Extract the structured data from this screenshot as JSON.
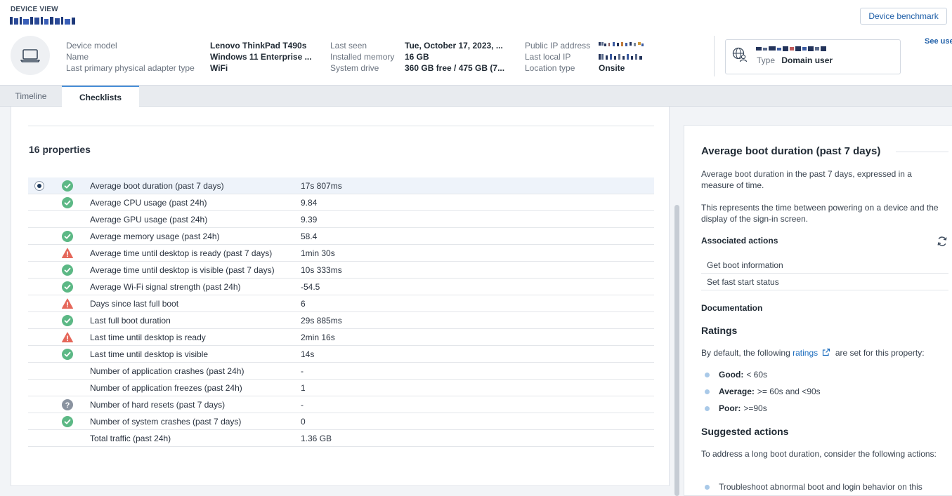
{
  "header": {
    "section_label": "DEVICE VIEW",
    "benchmark_button": "Device benchmark",
    "see_user_link": "See use",
    "properties": [
      {
        "label": "Device model",
        "value": "Lenovo ThinkPad T490s"
      },
      {
        "label": "Name",
        "value": "Windows 11 Enterprise ..."
      },
      {
        "label": "Last primary physical adapter type",
        "value": "WiFi"
      },
      {
        "label": "Last seen",
        "value": "Tue, October 17, 2023, ..."
      },
      {
        "label": "Installed memory",
        "value": "16 GB"
      },
      {
        "label": "System drive",
        "value": "360 GB free / 475 GB (7..."
      },
      {
        "label": "Public IP address",
        "value": ""
      },
      {
        "label": "Last local IP",
        "value": ""
      },
      {
        "label": "Location type",
        "value": "Onsite"
      }
    ],
    "user_card": {
      "type_label": "Type",
      "type_value": "Domain user"
    }
  },
  "tabs": [
    {
      "label": "Timeline",
      "active": false
    },
    {
      "label": "Checklists",
      "active": true
    }
  ],
  "main": {
    "properties_title": "16 properties",
    "rows": [
      {
        "name": "Average boot duration (past 7 days)",
        "value": "17s 807ms",
        "status": "good",
        "selected": true
      },
      {
        "name": "Average CPU usage (past 24h)",
        "value": "9.84",
        "status": "good"
      },
      {
        "name": "Average GPU usage (past 24h)",
        "value": "9.39",
        "status": "none"
      },
      {
        "name": "Average memory usage (past 24h)",
        "value": "58.4",
        "status": "good"
      },
      {
        "name": "Average time until desktop is ready (past 7 days)",
        "value": "1min 30s",
        "status": "warning"
      },
      {
        "name": "Average time until desktop is visible (past 7 days)",
        "value": "10s 333ms",
        "status": "good"
      },
      {
        "name": "Average Wi-Fi signal strength (past 24h)",
        "value": "-54.5",
        "status": "good"
      },
      {
        "name": "Days since last full boot",
        "value": "6",
        "status": "warning"
      },
      {
        "name": "Last full boot duration",
        "value": "29s 885ms",
        "status": "good"
      },
      {
        "name": "Last time until desktop is ready",
        "value": "2min 16s",
        "status": "warning"
      },
      {
        "name": "Last time until desktop is visible",
        "value": "14s",
        "status": "good"
      },
      {
        "name": "Number of application crashes (past 24h)",
        "value": "-",
        "status": "none"
      },
      {
        "name": "Number of application freezes (past 24h)",
        "value": "1",
        "status": "none"
      },
      {
        "name": "Number of hard resets (past 7 days)",
        "value": "-",
        "status": "unknown"
      },
      {
        "name": "Number of system crashes (past 7 days)",
        "value": "0",
        "status": "good"
      },
      {
        "name": "Total traffic (past 24h)",
        "value": "1.36 GB",
        "status": "none"
      }
    ]
  },
  "side": {
    "title": "Average boot duration (past 7 days)",
    "desc1": "Average boot duration in the past 7 days, expressed in a measure of time.",
    "desc2": "This represents the time between powering on a device and the display of the sign-in screen.",
    "associated_actions_title": "Associated actions",
    "actions": [
      "Get boot information",
      "Set fast start status"
    ],
    "documentation_title": "Documentation",
    "ratings_title": "Ratings",
    "ratings_intro_before": "By default, the following",
    "ratings_link": "ratings",
    "ratings_intro_after": "are set for this property:",
    "ratings": [
      {
        "label": "Good:",
        "value": "< 60s"
      },
      {
        "label": "Average:",
        "value": ">= 60s and <90s"
      },
      {
        "label": "Poor:",
        "value": ">=90s"
      }
    ],
    "suggested_title": "Suggested actions",
    "suggested_intro": "To address a long boot duration, consider the following actions:",
    "suggested_items": [
      "Troubleshoot abnormal boot and login behavior on this"
    ]
  },
  "colors": {
    "good": "#5cb885",
    "warning": "#e5675a",
    "unknown": "#8a93a0",
    "link": "#1f6fbf",
    "accent": "#4a90d9"
  }
}
